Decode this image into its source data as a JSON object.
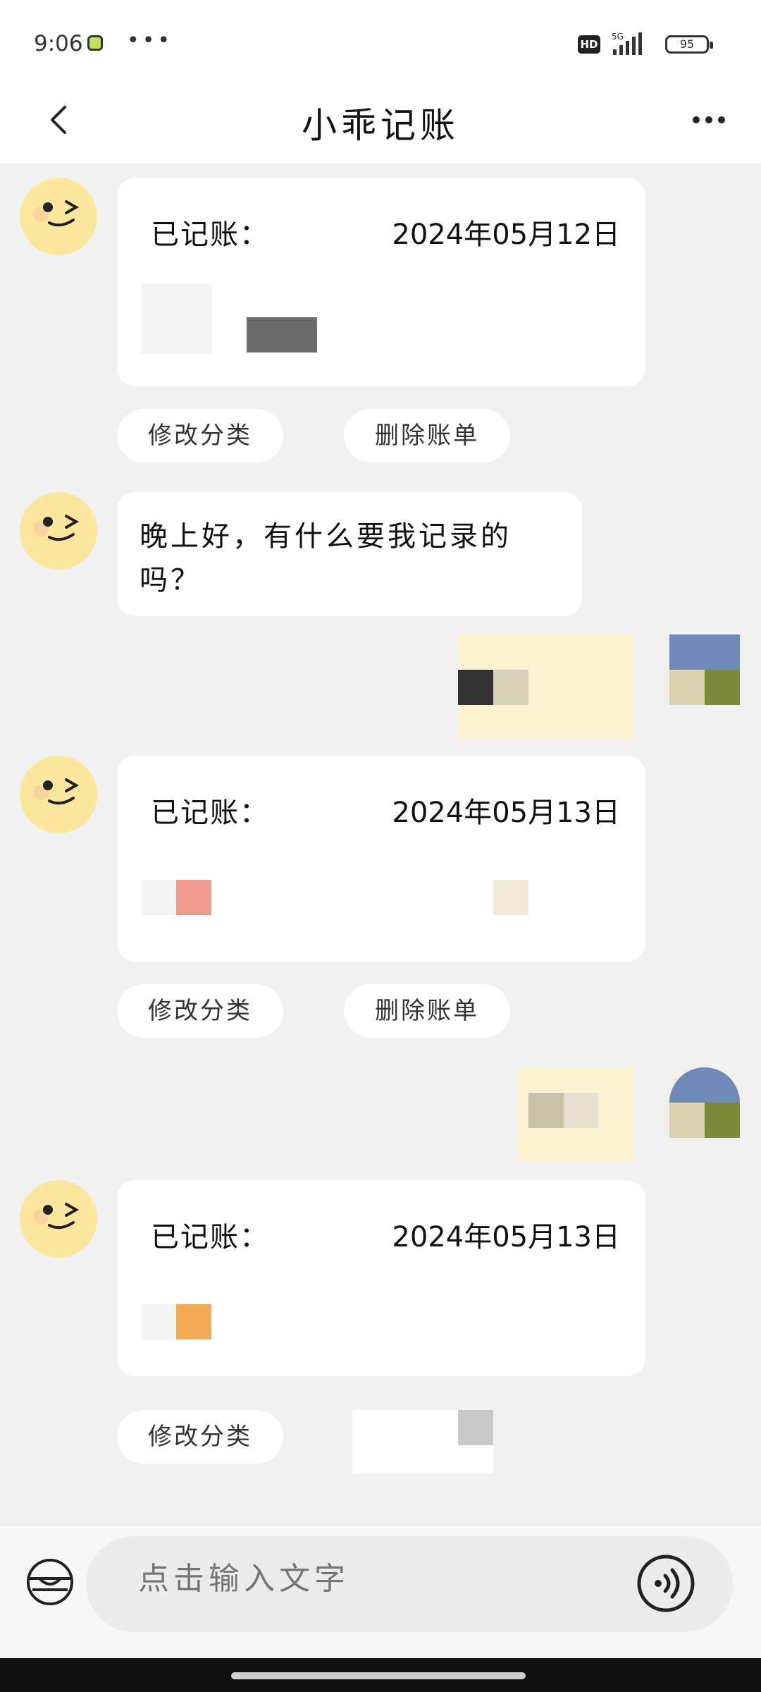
{
  "status_bar": {
    "time": "9:06",
    "more": "•••",
    "hd": "HD",
    "network": "5G",
    "battery": "95",
    "icons": [
      "app-notification-icon",
      "signal-icon",
      "battery-icon"
    ]
  },
  "header": {
    "title": "小乖记账",
    "back_icon": "chevron-left-icon",
    "more_icon": "more-icon"
  },
  "messages": [
    {
      "type": "record-card",
      "label": "已记账：",
      "date": "2024年05月12日",
      "actions": [
        "修改分类",
        "删除账单"
      ]
    },
    {
      "type": "text",
      "text": "晚上好，有什么要我记录的吗？"
    },
    {
      "type": "record-card",
      "label": "已记账：",
      "date": "2024年05月13日",
      "actions": [
        "修改分类",
        "删除账单"
      ]
    },
    {
      "type": "record-card",
      "label": "已记账：",
      "date": "2024年05月13日",
      "actions": [
        "修改分类"
      ]
    }
  ],
  "input": {
    "placeholder": "点击输入文字",
    "wallet_icon": "wallet-icon",
    "voice_icon": "voice-icon"
  },
  "colors": {
    "avatar": "#fbe89d",
    "user_bubble": "#fdf3d0",
    "background": "#f1f1f1"
  }
}
